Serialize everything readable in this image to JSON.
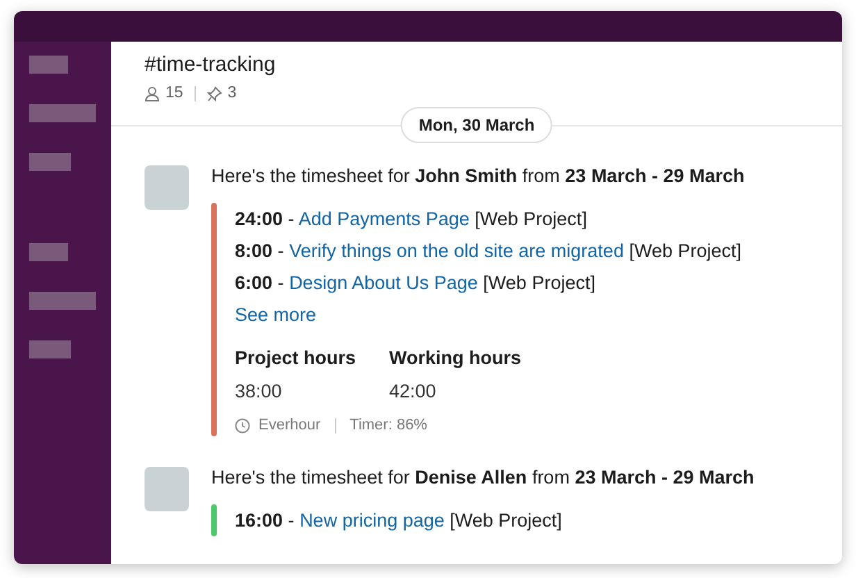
{
  "channel": {
    "name": "#time-tracking",
    "members": "15",
    "pins": "3"
  },
  "date": "Mon, 30 March",
  "messages": [
    {
      "intro": "Here's the timesheet for **John Smith** from **23 March - 29 March**",
      "color": "#d9735b",
      "entries": [
        {
          "hours": "24:00",
          "dash": "-",
          "task": "Add Payments Page",
          "project": "[Web Project]"
        },
        {
          "hours": "8:00",
          "dash": "-",
          "task": "Verify things on the old site are migrated",
          "project": "[Web Project]"
        },
        {
          "hours": "6:00",
          "dash": "-",
          "task": "Design About Us Page",
          "project": "[Web Project]"
        }
      ],
      "see_more": "See more",
      "stats": [
        {
          "label": "Project hours",
          "value": "38:00"
        },
        {
          "label": "Working hours",
          "value": "42:00"
        }
      ],
      "footer": {
        "app": "Everhour",
        "timer": "Timer: 86%"
      }
    },
    {
      "intro": "Here's the timesheet for **Denise Allen** from **23 March - 29 March**",
      "color": "#4cc96a",
      "entries": [
        {
          "hours": "16:00",
          "dash": "-",
          "task": "New pricing page",
          "project": "[Web Project]"
        }
      ]
    }
  ]
}
